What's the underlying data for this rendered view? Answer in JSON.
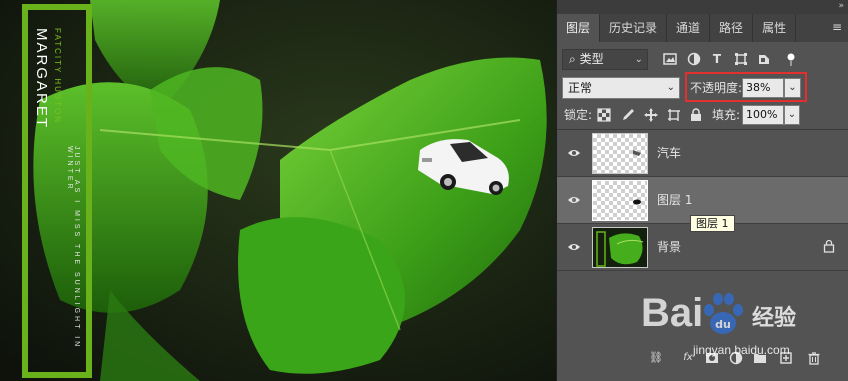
{
  "canvas": {
    "frame_title": "MARGARET",
    "frame_subtitle": "FATCITY HUSTON",
    "frame_tagline": "JUST AS I MISS THE SUNLIGHT IN WINTER",
    "frame_color": "#6ab21c"
  },
  "panel": {
    "collapse_icon": "»",
    "menu_icon": "≡",
    "tabs": [
      {
        "label": "图层",
        "active": true
      },
      {
        "label": "历史记录",
        "active": false
      },
      {
        "label": "通道",
        "active": false
      },
      {
        "label": "路径",
        "active": false
      },
      {
        "label": "属性",
        "active": false
      }
    ],
    "filter": {
      "search_icon": "⌕",
      "label": "类型",
      "icons": [
        "image-filter-icon",
        "adjustment-filter-icon",
        "type-filter-icon",
        "shape-filter-icon",
        "smart-object-filter-icon",
        "filter-toggle-icon"
      ]
    },
    "blend_mode": "正常",
    "opacity_label": "不透明度:",
    "opacity_value": "38%",
    "lock_label": "锁定:",
    "lock_icons": [
      "lock-transparent-icon",
      "lock-image-icon",
      "lock-position-icon",
      "lock-artboard-icon",
      "lock-all-icon"
    ],
    "fill_label": "填充:",
    "fill_value": "100%",
    "layers": [
      {
        "name": "汽车",
        "visible": true,
        "selected": false,
        "locked": false
      },
      {
        "name": "图层 1",
        "visible": true,
        "selected": true,
        "locked": false
      },
      {
        "name": "背景",
        "visible": true,
        "selected": false,
        "locked": true
      }
    ],
    "tooltip": "图层 1",
    "bottom_icons": [
      "link-icon",
      "fx-icon",
      "mask-icon",
      "adjustment-icon",
      "group-icon",
      "new-layer-icon",
      "trash-icon"
    ]
  },
  "watermark": {
    "logo": "Bai  经验",
    "brand_cn": "经验",
    "url": "jingyan.baidu.com"
  },
  "colors": {
    "highlight": "#e23030",
    "panel_bg": "#535353",
    "selected_layer": "#6b6b6b"
  }
}
